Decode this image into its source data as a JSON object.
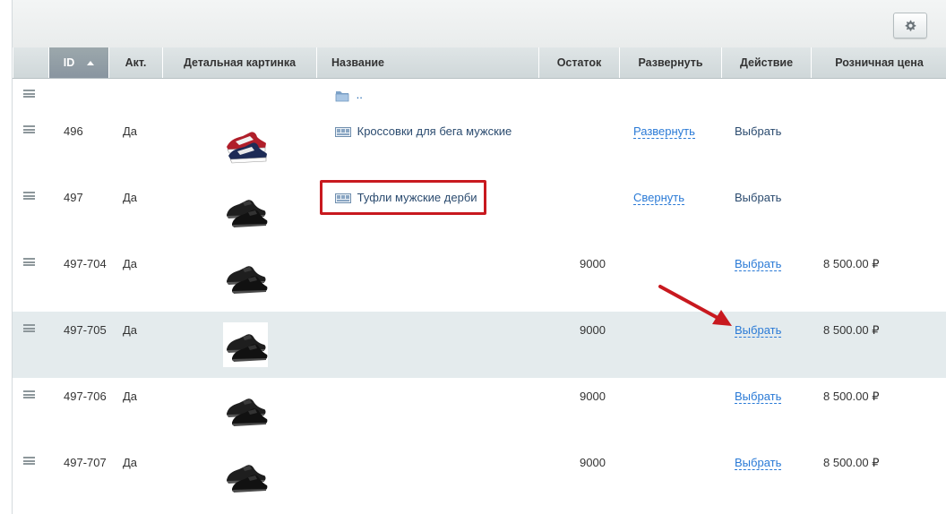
{
  "toolbar": {
    "settings_icon": "gear-icon"
  },
  "columns": [
    "ID",
    "Акт.",
    "Детальная картинка",
    "Название",
    "Остаток",
    "Развернуть",
    "Действие",
    "Розничная цена"
  ],
  "parent_row": {
    "name": "..",
    "icon": "folder-icon"
  },
  "rows": [
    {
      "id": "496",
      "active": "Да",
      "name": "Кроссовки для бега мужские",
      "stock": "",
      "expand": "Развернуть",
      "action": "Выбрать",
      "price": ""
    },
    {
      "id": "497",
      "active": "Да",
      "name": "Туфли мужские дерби",
      "stock": "",
      "expand": "Свернуть",
      "action": "Выбрать",
      "price": ""
    },
    {
      "id": "497-704",
      "active": "Да",
      "name": "",
      "stock": "9000",
      "expand": "",
      "action": "Выбрать",
      "price": "8 500.00 ₽"
    },
    {
      "id": "497-705",
      "active": "Да",
      "name": "",
      "stock": "9000",
      "expand": "",
      "action": "Выбрать",
      "price": "8 500.00 ₽"
    },
    {
      "id": "497-706",
      "active": "Да",
      "name": "",
      "stock": "9000",
      "expand": "",
      "action": "Выбрать",
      "price": "8 500.00 ₽"
    },
    {
      "id": "497-707",
      "active": "Да",
      "name": "",
      "stock": "9000",
      "expand": "",
      "action": "Выбрать",
      "price": "8 500.00 ₽"
    }
  ],
  "colors": {
    "highlight_box": "#c8191f",
    "arrow": "#c8191f",
    "link": "#2a7ad6",
    "selected_row": "#e4ebed"
  }
}
